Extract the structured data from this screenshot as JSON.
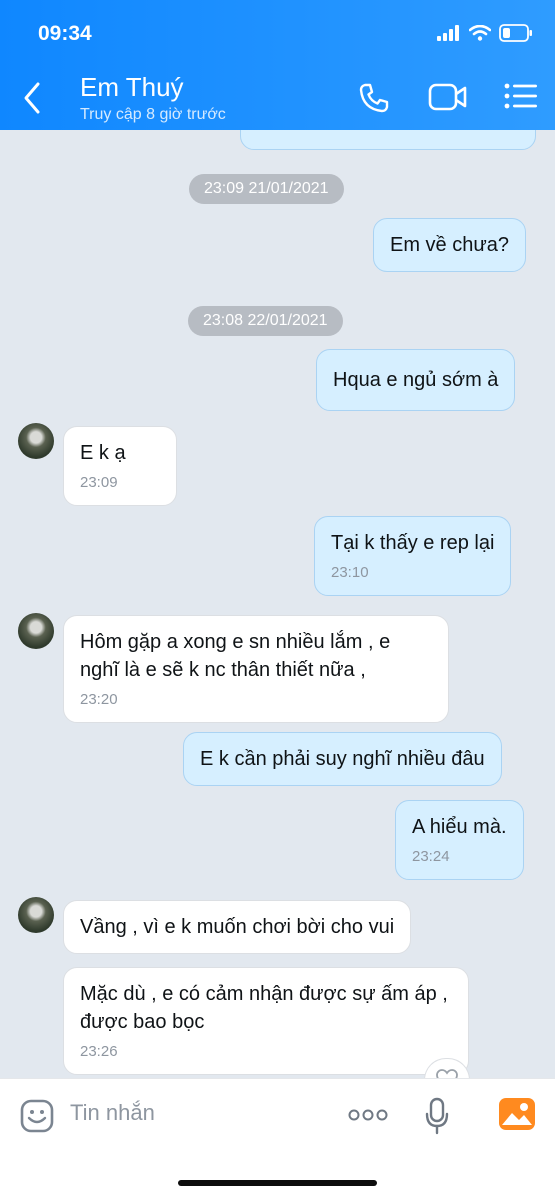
{
  "status": {
    "time": "09:34"
  },
  "header": {
    "name": "Em Thuý",
    "last_seen": "Truy cập 8 giờ trước"
  },
  "messages": [
    {
      "type": "timestamp",
      "text": "23:09 21/01/2021"
    },
    {
      "type": "out",
      "text": "Em về chưa?"
    },
    {
      "type": "timestamp",
      "text": "23:08 22/01/2021"
    },
    {
      "type": "out",
      "text": "Hqua e ngủ sớm à"
    },
    {
      "type": "in",
      "text": "E k ạ",
      "time": "23:09"
    },
    {
      "type": "out",
      "text": "Tại k thấy e rep lại",
      "time": "23:10"
    },
    {
      "type": "in",
      "text": "Hôm gặp a xong e sn nhiều lắm , e nghĩ là e sẽ k nc thân thiết nữa ,",
      "time": "23:20"
    },
    {
      "type": "out",
      "text": "E k cần phải suy nghĩ nhiều đâu"
    },
    {
      "type": "out",
      "text": "A hiểu mà.",
      "time": "23:24"
    },
    {
      "type": "in",
      "text": "Vầng , vì e k muốn chơi bời cho vui"
    },
    {
      "type": "in",
      "text": "Mặc dù , e có cảm nhận được sự ấm áp , được bao bọc",
      "time": "23:26"
    }
  ],
  "input": {
    "placeholder": "Tin nhắn"
  },
  "icons": {
    "back": "chevron-left-icon",
    "call": "phone-icon",
    "video": "video-icon",
    "menu": "list-icon",
    "emoji": "emoji-icon",
    "more": "more-dots-icon",
    "mic": "microphone-icon",
    "gallery": "image-icon",
    "react": "heart-icon"
  },
  "colors": {
    "header": "#1a8dff",
    "outgoing_bubble": "#d6efff",
    "incoming_bubble": "#ffffff",
    "background": "#e2e8ef",
    "gallery_icon": "#ff8a1f"
  }
}
